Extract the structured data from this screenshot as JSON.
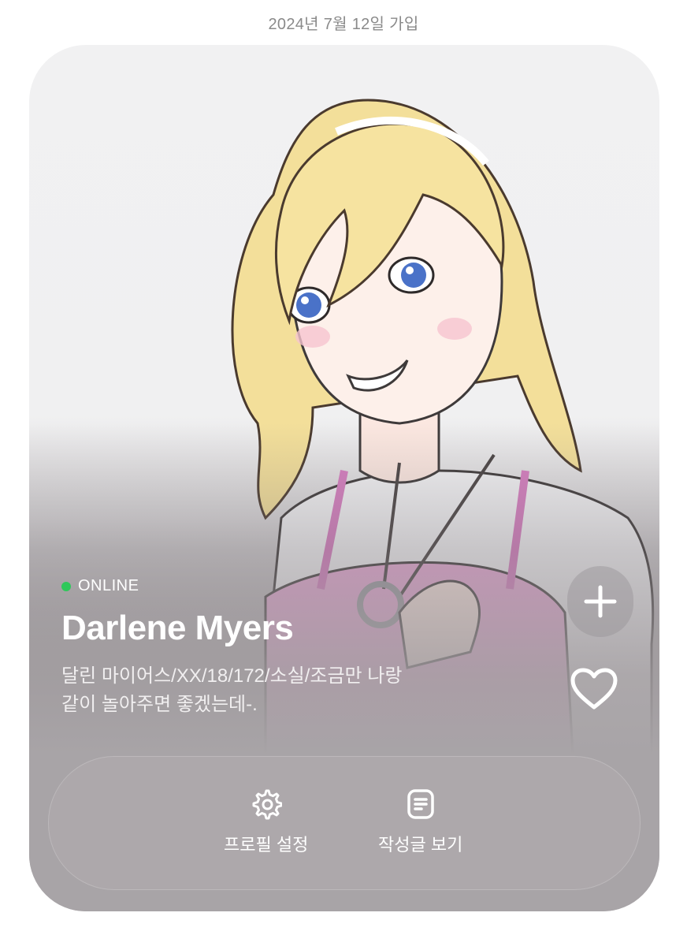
{
  "header": {
    "join_date": "2024년 7월 12일 가입"
  },
  "profile": {
    "status": "ONLINE",
    "status_color": "#2fc85a",
    "name": "Darlene Myers",
    "bio_line1": "달린 마이어스/XX/18/172/소실/조금만 나랑",
    "bio_line2": "같이 놀아주면 좋겠는데-."
  },
  "side_actions": {
    "add_icon": "plus-icon",
    "like_icon": "heart-icon"
  },
  "actions": {
    "settings_label": "프로필 설정",
    "settings_icon": "gear-icon",
    "posts_label": "작성글 보기",
    "posts_icon": "document-icon"
  }
}
